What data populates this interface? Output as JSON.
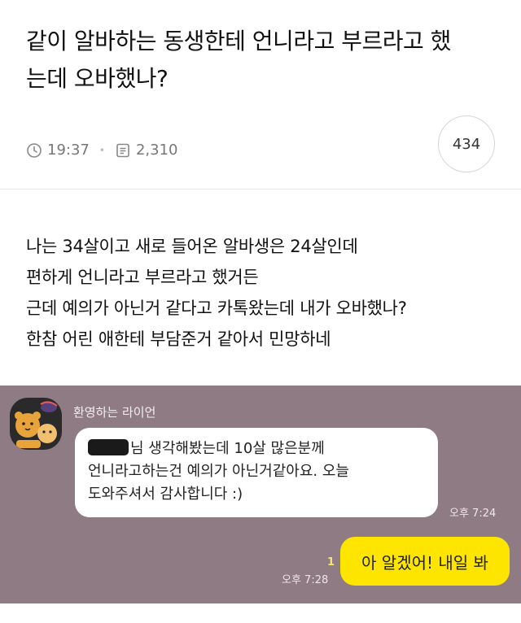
{
  "post": {
    "title_line1": "같이 알바하는 동생한테 언니라고 부르라고 했",
    "title_line2": "는데 오바했나?",
    "time": "19:37",
    "views": "2,310",
    "comment_count": "434",
    "body_lines": [
      "나는 34살이고 새로 들어온 알바생은 24살인데",
      "편하게 언니라고 부르라고 했거든",
      "근데 예의가 아닌거 같다고 카톡왔는데 내가 오바했나?",
      "한참 어린 애한테 부담준거 같아서 민망하네"
    ]
  },
  "chat": {
    "sender_name": "환영하는 라이언",
    "incoming_line1": "님 생각해봤는데 10살 많은분께",
    "incoming_line2": "언니라고하는건 예의가 아닌거같아요. 오늘",
    "incoming_line3": "도와주셔서 감사합니다 :)",
    "incoming_time": "오후 7:24",
    "outgoing_text": "아 알겠어! 내일 봐",
    "outgoing_read_count": "1",
    "outgoing_time": "오후 7:28",
    "colors": {
      "chat_bg": "#8f7b83",
      "outgoing_bubble": "#fee500",
      "incoming_bubble": "#ffffff"
    }
  }
}
